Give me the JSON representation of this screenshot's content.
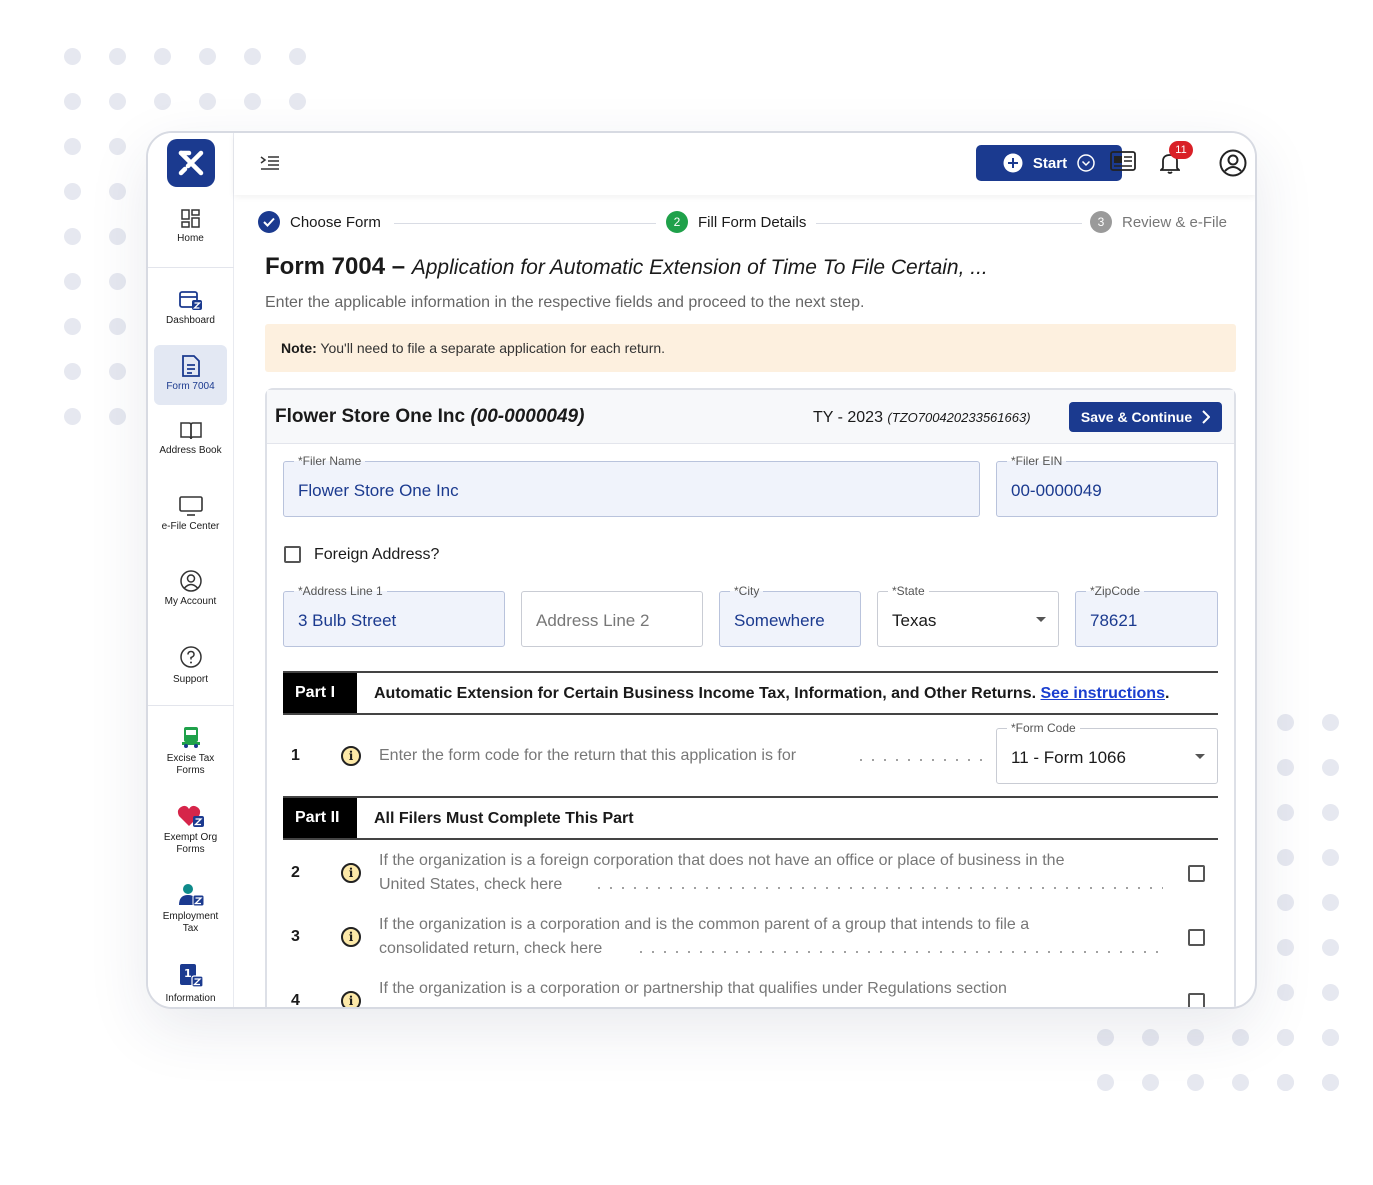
{
  "app": {
    "logo_alt": "TaxZerone"
  },
  "sidebar": {
    "items": [
      {
        "label": "Home",
        "icon": "dashboard-grid-icon"
      },
      {
        "label": "Dashboard",
        "icon": "calendar-icon"
      },
      {
        "label": "Form 7004",
        "icon": "document-icon",
        "active": true
      },
      {
        "label": "Address Book",
        "icon": "book-icon"
      },
      {
        "label": "e-File Center",
        "icon": "monitor-icon"
      },
      {
        "label": "My Account",
        "icon": "user-circle-icon"
      },
      {
        "label": "Support",
        "icon": "help-icon"
      },
      {
        "label": "Excise Tax Forms",
        "icon": "truck-icon"
      },
      {
        "label": "Exempt Org Forms",
        "icon": "heart-icon"
      },
      {
        "label": "Employment Tax",
        "icon": "employee-icon"
      },
      {
        "label": "Information",
        "icon": "info-doc-icon"
      }
    ]
  },
  "topbar": {
    "start_label": "Start",
    "notification_count": "11"
  },
  "stepper": {
    "steps": [
      {
        "label": "Choose Form",
        "state": "done",
        "number": ""
      },
      {
        "label": "Fill Form Details",
        "state": "current",
        "number": "2"
      },
      {
        "label": "Review & e-File",
        "state": "pending",
        "number": "3"
      }
    ]
  },
  "page": {
    "form_name": "Form 7004 –",
    "form_desc": "Application for Automatic Extension of Time To File Certain, ...",
    "subtitle": "Enter the applicable information in the respective fields and proceed to the next step.",
    "note_label": "Note:",
    "note_text": "You'll need to file a separate application for each return."
  },
  "card": {
    "company": "Flower Store One Inc",
    "ein_paren": "(00-0000049)",
    "ty": "TY - 2023",
    "submission_id": "(TZO700420233561663)",
    "save_label": "Save & Continue"
  },
  "fields": {
    "filer_name_label": "*Filer Name",
    "filer_name": "Flower Store One Inc",
    "filer_ein_label": "*Filer EIN",
    "filer_ein": "00-0000049",
    "foreign_label": "Foreign Address?",
    "address1_label": "*Address Line 1",
    "address1": "3 Bulb Street",
    "address2_placeholder": "Address Line 2",
    "city_label": "*City",
    "city": "Somewhere",
    "state_label": "*State",
    "state": "Texas",
    "zip_label": "*ZipCode",
    "zip": "78621"
  },
  "part1": {
    "tag": "Part I",
    "title": "Automatic Extension for Certain Business Income Tax, Information, and Other Returns.",
    "link": "See instructions",
    "line1_num": "1",
    "line1_text": "Enter the form code for the return that this application is for",
    "form_code_label": "*Form Code",
    "form_code": "11 - Form 1066"
  },
  "part2": {
    "tag": "Part II",
    "title": "All Filers Must Complete This Part",
    "lines": [
      {
        "num": "2",
        "text1": "If the organization is a foreign corporation that does not have an office or place of business in the",
        "text2": "United States, check here"
      },
      {
        "num": "3",
        "text1": "If the organization is a corporation and is the common parent of a group that intends to file a",
        "text2": "consolidated return, check here"
      },
      {
        "num": "4",
        "text1": "If the organization is a corporation or partnership that qualifies under Regulations section",
        "text2": ""
      }
    ]
  },
  "colors": {
    "brand": "#1b3a8f",
    "success": "#1fa14a",
    "pending": "#9a9a9a",
    "note_bg": "#fdf0df",
    "badge": "#d92027"
  }
}
